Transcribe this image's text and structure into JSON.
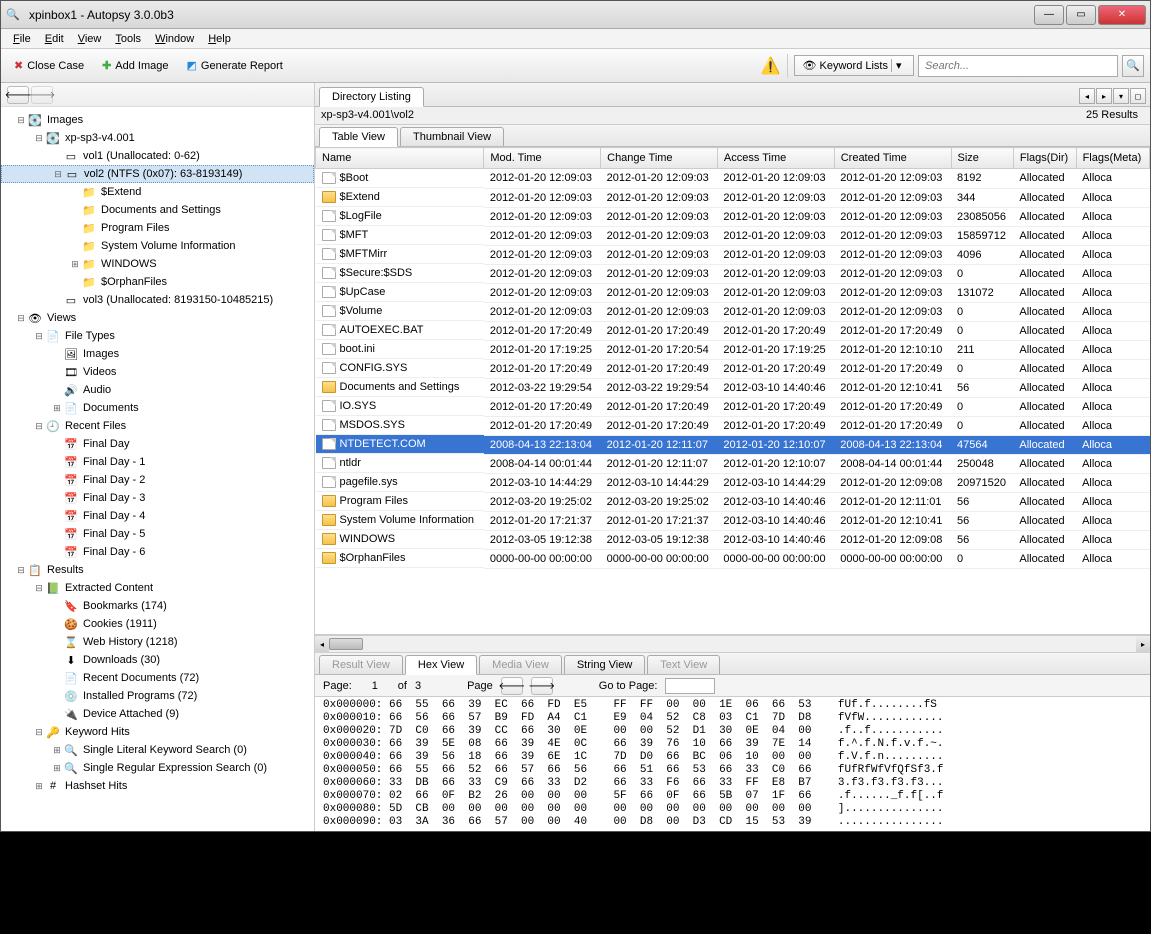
{
  "window": {
    "title": "xpinbox1 - Autopsy 3.0.0b3"
  },
  "menu": [
    "File",
    "Edit",
    "View",
    "Tools",
    "Window",
    "Help"
  ],
  "toolbar": {
    "close_case": "Close Case",
    "add_image": "Add Image",
    "generate_report": "Generate Report",
    "keyword_lists": "Keyword Lists",
    "search_placeholder": "Search..."
  },
  "tree": [
    {
      "d": 0,
      "t": "-",
      "i": "disk",
      "l": "Images"
    },
    {
      "d": 1,
      "t": "-",
      "i": "disk",
      "l": "xp-sp3-v4.001"
    },
    {
      "d": 2,
      "t": "",
      "i": "vol",
      "l": "vol1 (Unallocated: 0-62)"
    },
    {
      "d": 2,
      "t": "-",
      "i": "vol",
      "l": "vol2 (NTFS (0x07): 63-8193149)",
      "sel": true
    },
    {
      "d": 3,
      "t": "",
      "i": "folder",
      "l": "$Extend"
    },
    {
      "d": 3,
      "t": "",
      "i": "folder",
      "l": "Documents and Settings"
    },
    {
      "d": 3,
      "t": "",
      "i": "folder",
      "l": "Program Files"
    },
    {
      "d": 3,
      "t": "",
      "i": "folder",
      "l": "System Volume Information"
    },
    {
      "d": 3,
      "t": "+",
      "i": "folder",
      "l": "WINDOWS"
    },
    {
      "d": 3,
      "t": "",
      "i": "folder",
      "l": "$OrphanFiles"
    },
    {
      "d": 2,
      "t": "",
      "i": "vol",
      "l": "vol3 (Unallocated: 8193150-10485215)"
    },
    {
      "d": 0,
      "t": "-",
      "i": "views",
      "l": "Views"
    },
    {
      "d": 1,
      "t": "-",
      "i": "ft",
      "l": "File Types"
    },
    {
      "d": 2,
      "t": "",
      "i": "img",
      "l": "Images"
    },
    {
      "d": 2,
      "t": "",
      "i": "vid",
      "l": "Videos"
    },
    {
      "d": 2,
      "t": "",
      "i": "aud",
      "l": "Audio"
    },
    {
      "d": 2,
      "t": "+",
      "i": "doc",
      "l": "Documents"
    },
    {
      "d": 1,
      "t": "-",
      "i": "rf",
      "l": "Recent Files"
    },
    {
      "d": 2,
      "t": "",
      "i": "day",
      "l": "Final Day"
    },
    {
      "d": 2,
      "t": "",
      "i": "day",
      "l": "Final Day - 1"
    },
    {
      "d": 2,
      "t": "",
      "i": "day",
      "l": "Final Day - 2"
    },
    {
      "d": 2,
      "t": "",
      "i": "day",
      "l": "Final Day - 3"
    },
    {
      "d": 2,
      "t": "",
      "i": "day",
      "l": "Final Day - 4"
    },
    {
      "d": 2,
      "t": "",
      "i": "day",
      "l": "Final Day - 5"
    },
    {
      "d": 2,
      "t": "",
      "i": "day",
      "l": "Final Day - 6"
    },
    {
      "d": 0,
      "t": "-",
      "i": "res",
      "l": "Results"
    },
    {
      "d": 1,
      "t": "-",
      "i": "ext",
      "l": "Extracted Content"
    },
    {
      "d": 2,
      "t": "",
      "i": "bm",
      "l": "Bookmarks (174)"
    },
    {
      "d": 2,
      "t": "",
      "i": "ck",
      "l": "Cookies (1911)"
    },
    {
      "d": 2,
      "t": "",
      "i": "wh",
      "l": "Web History (1218)"
    },
    {
      "d": 2,
      "t": "",
      "i": "dl",
      "l": "Downloads (30)"
    },
    {
      "d": 2,
      "t": "",
      "i": "rd",
      "l": "Recent Documents (72)"
    },
    {
      "d": 2,
      "t": "",
      "i": "ip",
      "l": "Installed Programs (72)"
    },
    {
      "d": 2,
      "t": "",
      "i": "da",
      "l": "Device Attached (9)"
    },
    {
      "d": 1,
      "t": "-",
      "i": "kw",
      "l": "Keyword Hits"
    },
    {
      "d": 2,
      "t": "+",
      "i": "kws",
      "l": "Single Literal Keyword Search (0)"
    },
    {
      "d": 2,
      "t": "+",
      "i": "kws",
      "l": "Single Regular Expression Search (0)"
    },
    {
      "d": 1,
      "t": "+",
      "i": "hh",
      "l": "Hashset Hits"
    }
  ],
  "listing": {
    "tab": "Directory Listing",
    "path": "xp-sp3-v4.001\\vol2",
    "results": "25 Results",
    "view_tabs": [
      "Table View",
      "Thumbnail View"
    ],
    "columns": [
      "Name",
      "Mod. Time",
      "Change Time",
      "Access Time",
      "Created Time",
      "Size",
      "Flags(Dir)",
      "Flags(Meta)"
    ],
    "rows": [
      {
        "i": "file",
        "n": "$Boot",
        "m": "2012-01-20 12:09:03",
        "c": "2012-01-20 12:09:03",
        "a": "2012-01-20 12:09:03",
        "cr": "2012-01-20 12:09:03",
        "s": "8192",
        "fd": "Allocated",
        "fm": "Alloca"
      },
      {
        "i": "folder",
        "n": "$Extend",
        "m": "2012-01-20 12:09:03",
        "c": "2012-01-20 12:09:03",
        "a": "2012-01-20 12:09:03",
        "cr": "2012-01-20 12:09:03",
        "s": "344",
        "fd": "Allocated",
        "fm": "Alloca"
      },
      {
        "i": "file",
        "n": "$LogFile",
        "m": "2012-01-20 12:09:03",
        "c": "2012-01-20 12:09:03",
        "a": "2012-01-20 12:09:03",
        "cr": "2012-01-20 12:09:03",
        "s": "23085056",
        "fd": "Allocated",
        "fm": "Alloca"
      },
      {
        "i": "file",
        "n": "$MFT",
        "m": "2012-01-20 12:09:03",
        "c": "2012-01-20 12:09:03",
        "a": "2012-01-20 12:09:03",
        "cr": "2012-01-20 12:09:03",
        "s": "15859712",
        "fd": "Allocated",
        "fm": "Alloca"
      },
      {
        "i": "file",
        "n": "$MFTMirr",
        "m": "2012-01-20 12:09:03",
        "c": "2012-01-20 12:09:03",
        "a": "2012-01-20 12:09:03",
        "cr": "2012-01-20 12:09:03",
        "s": "4096",
        "fd": "Allocated",
        "fm": "Alloca"
      },
      {
        "i": "file",
        "n": "$Secure:$SDS",
        "m": "2012-01-20 12:09:03",
        "c": "2012-01-20 12:09:03",
        "a": "2012-01-20 12:09:03",
        "cr": "2012-01-20 12:09:03",
        "s": "0",
        "fd": "Allocated",
        "fm": "Alloca"
      },
      {
        "i": "file",
        "n": "$UpCase",
        "m": "2012-01-20 12:09:03",
        "c": "2012-01-20 12:09:03",
        "a": "2012-01-20 12:09:03",
        "cr": "2012-01-20 12:09:03",
        "s": "131072",
        "fd": "Allocated",
        "fm": "Alloca"
      },
      {
        "i": "file",
        "n": "$Volume",
        "m": "2012-01-20 12:09:03",
        "c": "2012-01-20 12:09:03",
        "a": "2012-01-20 12:09:03",
        "cr": "2012-01-20 12:09:03",
        "s": "0",
        "fd": "Allocated",
        "fm": "Alloca"
      },
      {
        "i": "file",
        "n": "AUTOEXEC.BAT",
        "m": "2012-01-20 17:20:49",
        "c": "2012-01-20 17:20:49",
        "a": "2012-01-20 17:20:49",
        "cr": "2012-01-20 17:20:49",
        "s": "0",
        "fd": "Allocated",
        "fm": "Alloca"
      },
      {
        "i": "file",
        "n": "boot.ini",
        "m": "2012-01-20 17:19:25",
        "c": "2012-01-20 17:20:54",
        "a": "2012-01-20 17:19:25",
        "cr": "2012-01-20 12:10:10",
        "s": "211",
        "fd": "Allocated",
        "fm": "Alloca"
      },
      {
        "i": "file",
        "n": "CONFIG.SYS",
        "m": "2012-01-20 17:20:49",
        "c": "2012-01-20 17:20:49",
        "a": "2012-01-20 17:20:49",
        "cr": "2012-01-20 17:20:49",
        "s": "0",
        "fd": "Allocated",
        "fm": "Alloca"
      },
      {
        "i": "folder",
        "n": "Documents and Settings",
        "m": "2012-03-22 19:29:54",
        "c": "2012-03-22 19:29:54",
        "a": "2012-03-10 14:40:46",
        "cr": "2012-01-20 12:10:41",
        "s": "56",
        "fd": "Allocated",
        "fm": "Alloca"
      },
      {
        "i": "file",
        "n": "IO.SYS",
        "m": "2012-01-20 17:20:49",
        "c": "2012-01-20 17:20:49",
        "a": "2012-01-20 17:20:49",
        "cr": "2012-01-20 17:20:49",
        "s": "0",
        "fd": "Allocated",
        "fm": "Alloca"
      },
      {
        "i": "file",
        "n": "MSDOS.SYS",
        "m": "2012-01-20 17:20:49",
        "c": "2012-01-20 17:20:49",
        "a": "2012-01-20 17:20:49",
        "cr": "2012-01-20 17:20:49",
        "s": "0",
        "fd": "Allocated",
        "fm": "Alloca"
      },
      {
        "i": "file",
        "n": "NTDETECT.COM",
        "m": "2008-04-13 22:13:04",
        "c": "2012-01-20 12:11:07",
        "a": "2012-01-20 12:10:07",
        "cr": "2008-04-13 22:13:04",
        "s": "47564",
        "fd": "Allocated",
        "fm": "Alloca",
        "sel": true
      },
      {
        "i": "file",
        "n": "ntldr",
        "m": "2008-04-14 00:01:44",
        "c": "2012-01-20 12:11:07",
        "a": "2012-01-20 12:10:07",
        "cr": "2008-04-14 00:01:44",
        "s": "250048",
        "fd": "Allocated",
        "fm": "Alloca"
      },
      {
        "i": "file",
        "n": "pagefile.sys",
        "m": "2012-03-10 14:44:29",
        "c": "2012-03-10 14:44:29",
        "a": "2012-03-10 14:44:29",
        "cr": "2012-01-20 12:09:08",
        "s": "20971520",
        "fd": "Allocated",
        "fm": "Alloca"
      },
      {
        "i": "folder",
        "n": "Program Files",
        "m": "2012-03-20 19:25:02",
        "c": "2012-03-20 19:25:02",
        "a": "2012-03-10 14:40:46",
        "cr": "2012-01-20 12:11:01",
        "s": "56",
        "fd": "Allocated",
        "fm": "Alloca"
      },
      {
        "i": "folder",
        "n": "System Volume Information",
        "m": "2012-01-20 17:21:37",
        "c": "2012-01-20 17:21:37",
        "a": "2012-03-10 14:40:46",
        "cr": "2012-01-20 12:10:41",
        "s": "56",
        "fd": "Allocated",
        "fm": "Alloca"
      },
      {
        "i": "folder",
        "n": "WINDOWS",
        "m": "2012-03-05 19:12:38",
        "c": "2012-03-05 19:12:38",
        "a": "2012-03-10 14:40:46",
        "cr": "2012-01-20 12:09:08",
        "s": "56",
        "fd": "Allocated",
        "fm": "Alloca"
      },
      {
        "i": "folder",
        "n": "$OrphanFiles",
        "m": "0000-00-00 00:00:00",
        "c": "0000-00-00 00:00:00",
        "a": "0000-00-00 00:00:00",
        "cr": "0000-00-00 00:00:00",
        "s": "0",
        "fd": "Allocated",
        "fm": "Alloca"
      }
    ]
  },
  "viewer": {
    "tabs": [
      "Result View",
      "Hex View",
      "Media View",
      "String View",
      "Text View"
    ],
    "page_label": "Page:",
    "page_cur": "1",
    "page_of": "of",
    "page_tot": "3",
    "page_word": "Page",
    "goto": "Go to Page:",
    "hex": "0x000000: 66  55  66  39  EC  66  FD  E5    FF  FF  00  00  1E  06  66  53    fUf.f........fS\n0x000010: 66  56  66  57  B9  FD  A4  C1    E9  04  52  C8  03  C1  7D  D8    fVfW............\n0x000020: 7D  C0  66  39  CC  66  30  0E    00  00  52  D1  30  0E  04  00    .f..f...........\n0x000030: 66  39  5E  08  66  39  4E  0C    66  39  76  10  66  39  7E  14    f.^.f.N.f.v.f.~.\n0x000040: 66  39  56  18  66  39  6E  1C    7D  D0  66  BC  06  10  00  00    f.V.f.n.........\n0x000050: 66  55  66  52  66  57  66  56    66  51  66  53  66  33  C0  66    fUfRfWfVfQfSf3.f\n0x000060: 33  DB  66  33  C9  66  33  D2    66  33  F6  66  33  FF  E8  B7    3.f3.f3.f3.f3...\n0x000070: 02  66  0F  B2  26  00  00  00    5F  66  0F  66  5B  07  1F  66    .f......_f.f[..f\n0x000080: 5D  CB  00  00  00  00  00  00    00  00  00  00  00  00  00  00    ]...............\n0x000090: 03  3A  36  66  57  00  00  40    00  D8  00  D3  CD  15  53  39    ................"
  }
}
